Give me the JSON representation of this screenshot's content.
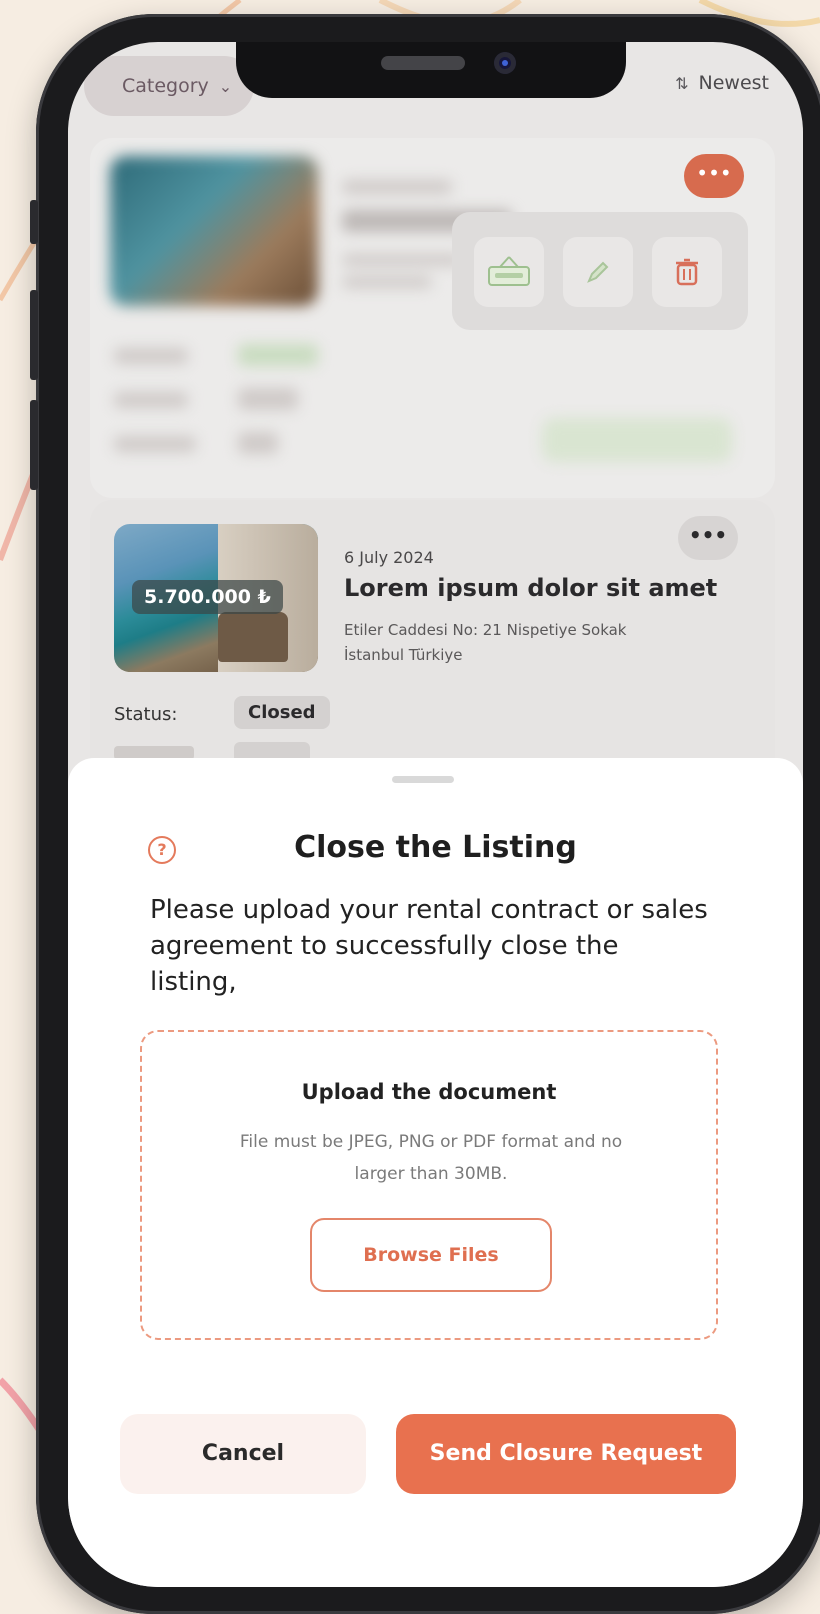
{
  "topbar": {
    "category_label": "Category",
    "sort_label": "Newest"
  },
  "listing": {
    "price": "5.700.000 ₺",
    "date": "6 July 2024",
    "title": "Lorem ipsum dolor sit amet",
    "address_line1": "Etiler Caddesi No: 21 Nispetiye Sokak",
    "address_line2": "İstanbul Türkiye",
    "status_label": "Status:",
    "status_value": "Closed",
    "more_icon": "more-dots-icon"
  },
  "actions_menu": {
    "icons": [
      "closed-sign-icon",
      "pencil-icon",
      "trash-icon"
    ]
  },
  "sheet": {
    "title": "Close the Listing",
    "help_icon": "help-icon",
    "description": "Please upload your rental contract or sales agreement to successfully close the listing,",
    "upload_title": "Upload the document",
    "upload_hint": "File must be JPEG, PNG or PDF format and no larger than 30MB.",
    "browse_label": "Browse Files",
    "cancel_label": "Cancel",
    "send_label": "Send Closure Request"
  },
  "colors": {
    "accent": "#e8714f",
    "background": "#f6ede2",
    "cancel_bg": "#fbf1ee"
  }
}
